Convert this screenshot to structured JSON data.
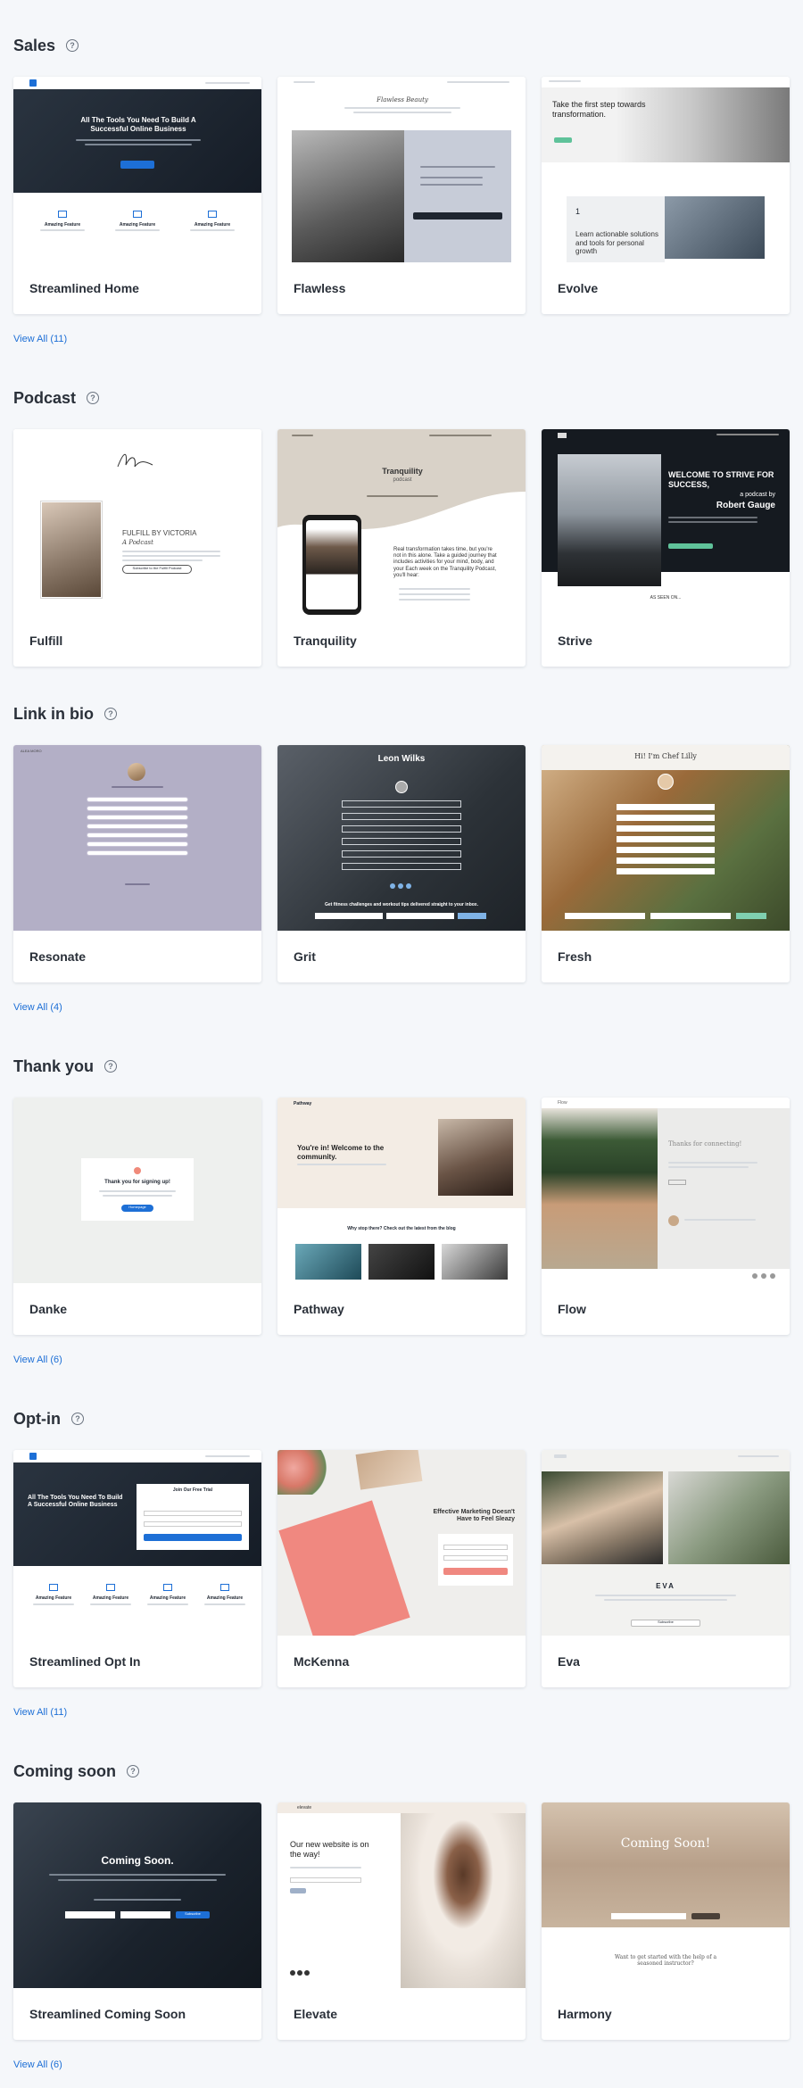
{
  "sections": [
    {
      "title": "Sales",
      "view_all": "View All (11)",
      "cards": [
        {
          "name": "Streamlined Home",
          "heading": "All The Tools You Need To Build A Successful Online Business",
          "features": [
            "Amazing Feature",
            "Amazing Feature",
            "Amazing Feature"
          ]
        },
        {
          "name": "Flawless",
          "heading": "Flawless Beauty"
        },
        {
          "name": "Evolve",
          "heading": "Take the first step towards transformation.",
          "sub": "Learn actionable solutions and tools for personal growth",
          "number": "1"
        }
      ]
    },
    {
      "title": "Podcast",
      "view_all": "",
      "cards": [
        {
          "name": "Fulfill",
          "heading": "FULFILL BY VICTORIA",
          "sub": "A Podcast",
          "button": "Subscribe to the Fulfill Podcast"
        },
        {
          "name": "Tranquility",
          "heading": "Tranquility",
          "sub": "podcast",
          "body": "Real transformation takes time, but you're not in this alone. Take a guided journey that includes activities for your mind, body, and your Each week on the Tranquility Podcast, you'll hear:"
        },
        {
          "name": "Strive",
          "heading": "WELCOME TO STRIVE FOR SUCCESS,",
          "sub": "a podcast by",
          "author": "Robert Gauge",
          "footer": "AS SEEN ON..."
        }
      ]
    },
    {
      "title": "Link in bio",
      "view_all": "View All (4)",
      "cards": [
        {
          "name": "Resonate",
          "brand": "ALEA MORO"
        },
        {
          "name": "Grit",
          "heading": "Leon Wilks",
          "footer": "Get fitness challenges and workout tips delivered straight to your inbox."
        },
        {
          "name": "Fresh",
          "heading": "Hi! I'm Chef Lilly"
        }
      ]
    },
    {
      "title": "Thank you",
      "view_all": "View All (6)",
      "cards": [
        {
          "name": "Danke",
          "heading": "Thank you for signing up!",
          "button": "Homepage"
        },
        {
          "name": "Pathway",
          "brand": "Pathway",
          "heading": "You're in! Welcome to the community.",
          "sub": "Why stop there? Check out the latest from the blog"
        },
        {
          "name": "Flow",
          "brand": "Flow",
          "heading": "Thanks for connecting!"
        }
      ]
    },
    {
      "title": "Opt-in",
      "view_all": "View All (11)",
      "cards": [
        {
          "name": "Streamlined Opt In",
          "heading": "All The Tools You Need To Build A Successful Online Business",
          "form_title": "Join Our Free Trial",
          "features": [
            "Amazing Feature",
            "Amazing Feature",
            "Amazing Feature",
            "Amazing Feature"
          ]
        },
        {
          "name": "McKenna",
          "heading": "Effective Marketing Doesn't Have to Feel Sleazy"
        },
        {
          "name": "Eva",
          "heading": "EVA",
          "button": "Subscribe"
        }
      ]
    },
    {
      "title": "Coming soon",
      "view_all": "View All (6)",
      "cards": [
        {
          "name": "Streamlined Coming Soon",
          "heading": "Coming Soon.",
          "button": "Subscribe"
        },
        {
          "name": "Elevate",
          "brand": "elevate",
          "heading": "Our new website is on the way!"
        },
        {
          "name": "Harmony",
          "heading": "Coming Soon!",
          "sub": "Want to get started with the help of a seasoned instructor?"
        }
      ]
    }
  ],
  "colors": {
    "accent": "#1d6fd6",
    "title": "#2a3039",
    "background": "#f5f7fa"
  }
}
